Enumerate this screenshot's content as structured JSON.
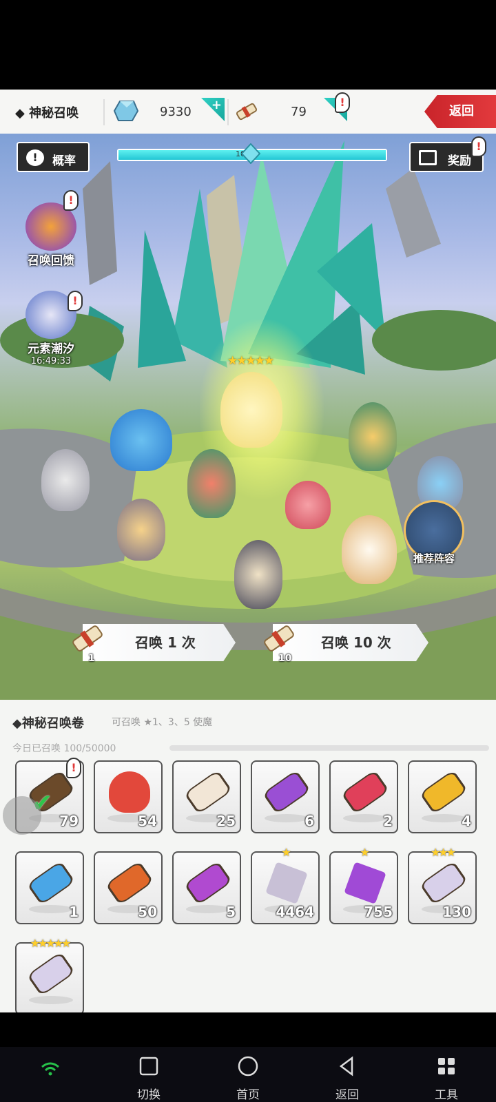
{
  "topbar": {
    "title": "◆ 神秘召唤",
    "gems": "9330",
    "scrolls": "79",
    "plus": "+",
    "alert": "!",
    "back_label": "返回"
  },
  "scene": {
    "rate_label": "概率",
    "reward_label": "奖励",
    "progress_text": "100",
    "progress_fraction": 1.0,
    "feedback_label": "召唤回馈",
    "tide_label": "元素潮汐",
    "tide_time": "16:49:33",
    "five_stars": "★★★★★",
    "team_label": "推荐阵容",
    "summon_once": "召唤 1 次",
    "summon_once_count": "1",
    "summon_ten": "召唤 10 次",
    "summon_ten_count": "10"
  },
  "panel": {
    "title": "◆神秘召唤卷",
    "subtitle": "可召唤 ★1、3、5 使魔",
    "today": "今日已召唤  100/50000",
    "items": [
      {
        "name": "mystic-scroll",
        "count": "79",
        "color": "#6b4a2a"
      },
      {
        "name": "heart",
        "count": "54",
        "color": "#e2483b"
      },
      {
        "name": "shell-scroll",
        "count": "25",
        "color": "#f2e6d6"
      },
      {
        "name": "purple-scroll",
        "count": "6",
        "color": "#9a4fd4"
      },
      {
        "name": "red-scroll",
        "count": "2",
        "color": "#e0405a"
      },
      {
        "name": "gold-scroll",
        "count": "4",
        "color": "#f0b82a"
      },
      {
        "name": "blue-scroll",
        "count": "1",
        "color": "#4aa6e6"
      },
      {
        "name": "fire-scroll",
        "count": "50",
        "color": "#e0682a"
      },
      {
        "name": "violet-scroll",
        "count": "5",
        "color": "#b04ad0"
      },
      {
        "name": "white-shard",
        "count": "4464",
        "color": "#c8c0d6",
        "stars": "★"
      },
      {
        "name": "purple-shard",
        "count": "755",
        "color": "#a04ad6",
        "stars": "★"
      },
      {
        "name": "ring-crystal",
        "count": "130",
        "color": "#d8d0ea",
        "stars": "★★★"
      },
      {
        "name": "five-star-crystal",
        "count": "",
        "color": "#d8d0ea",
        "stars": "★★★★★"
      }
    ]
  },
  "navbar": {
    "switch": "切换",
    "home": "首页",
    "back": "返回",
    "tools": "工具"
  }
}
